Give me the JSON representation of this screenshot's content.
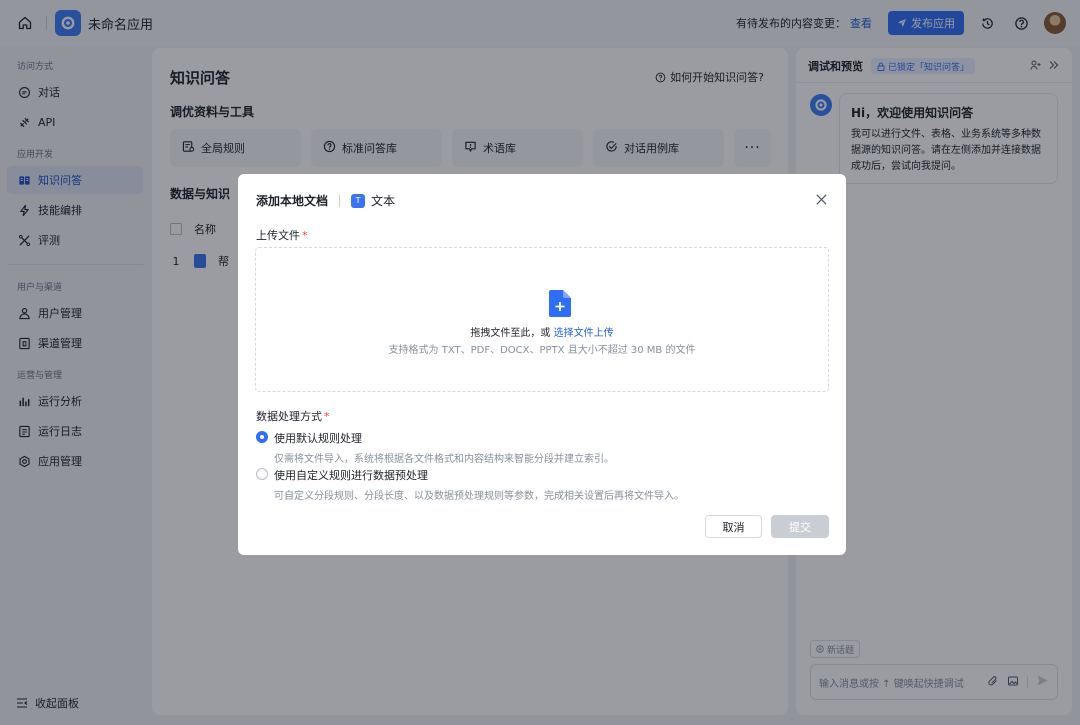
{
  "topbar": {
    "app_name": "未命名应用",
    "pending_text": "有待发布的内容变更：",
    "pending_link": "查看",
    "publish_label": "发布应用"
  },
  "sidebar": {
    "groups": [
      {
        "title": "访问方式",
        "items": [
          {
            "label": "对话",
            "icon": "chat-icon"
          },
          {
            "label": "API",
            "icon": "api-icon"
          }
        ]
      },
      {
        "title": "应用开发",
        "items": [
          {
            "label": "知识问答",
            "icon": "book-icon",
            "active": true
          },
          {
            "label": "技能编排",
            "icon": "flash-icon"
          },
          {
            "label": "评测",
            "icon": "evaluate-icon"
          }
        ]
      },
      {
        "title": "用户与渠道",
        "items": [
          {
            "label": "用户管理",
            "icon": "users-icon"
          },
          {
            "label": "渠道管理",
            "icon": "channel-icon"
          }
        ]
      },
      {
        "title": "运营与管理",
        "items": [
          {
            "label": "运行分析",
            "icon": "bar-chart-icon"
          },
          {
            "label": "运行日志",
            "icon": "log-icon"
          },
          {
            "label": "应用管理",
            "icon": "settings-icon"
          }
        ]
      }
    ],
    "collapse_label": "收起面板"
  },
  "main": {
    "title": "知识问答",
    "help_link": "如何开始知识问答?",
    "tools_title": "调优资料与工具",
    "tools": [
      {
        "label": "全局规则",
        "icon": "rule-icon"
      },
      {
        "label": "标准问答库",
        "icon": "help-circle-icon"
      },
      {
        "label": "术语库",
        "icon": "glossary-icon"
      },
      {
        "label": "对话用例库",
        "icon": "check-circle-icon"
      }
    ],
    "more_label": "···",
    "data_title": "数据与知识",
    "table_header_name": "名称",
    "row_index": "1",
    "row_name_visible": "帮"
  },
  "preview": {
    "title": "调试和预览",
    "lock_badge": "已锁定「知识问答」",
    "greeting": "Hi，欢迎使用知识问答",
    "intro": "我可以进行文件、表格、业务系统等多种数据源的知识问答。请在左侧添加并连接数据成功后，尝试向我提问。",
    "new_topic": "新话题",
    "input_placeholder": "输入消息或按 ↑ 键唤起快捷调试"
  },
  "modal": {
    "title": "添加本地文档",
    "type_label": "文本",
    "type_badge": "T",
    "upload_label": "上传文件",
    "required_mark": "*",
    "drop_text": "拖拽文件至此，或",
    "drop_link": "选择文件上传",
    "drop_hint": "支持格式为 TXT、PDF、DOCX、PPTX 且大小不超过 30 MB 的文件",
    "processing_label": "数据处理方式",
    "options": [
      {
        "title": "使用默认规则处理",
        "desc": "仅需将文件导入，系统将根据各文件格式和内容结构来智能分段并建立索引。",
        "checked": true
      },
      {
        "title": "使用自定义规则进行数据预处理",
        "desc": "可自定义分段规则、分段长度、以及数据预处理规则等参数，完成相关设置后再将文件导入。",
        "checked": false
      }
    ],
    "cancel_label": "取消",
    "submit_label": "提交"
  },
  "colors": {
    "accent": "#2f6ef6",
    "required": "#f53f3f",
    "overlay": "rgba(15,20,32,0.42)"
  }
}
